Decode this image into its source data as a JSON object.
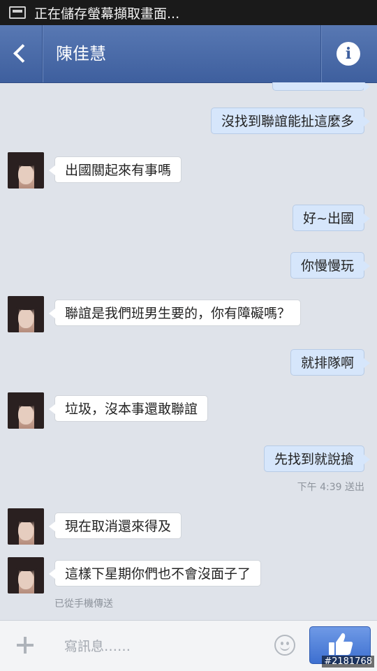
{
  "status_bar": {
    "notification_text": "正在儲存螢幕擷取畫面..."
  },
  "header": {
    "contact_name": "陳佳慧",
    "info_glyph": "i"
  },
  "messages": [
    {
      "dir": "out",
      "text": "沒找到聯誼能扯這麼多"
    },
    {
      "dir": "in",
      "text": "出國關起來有事嗎"
    },
    {
      "dir": "out",
      "text": "好~出國"
    },
    {
      "dir": "out",
      "text": "你慢慢玩"
    },
    {
      "dir": "in",
      "text": "聯誼是我們班男生要的，你有障礙嗎？"
    },
    {
      "dir": "out",
      "text": "就排隊啊"
    },
    {
      "dir": "in",
      "text": "垃圾，沒本事還敢聯誼"
    },
    {
      "dir": "out",
      "text": "先找到就說搶"
    },
    {
      "dir": "in",
      "text": "現在取消還來得及"
    },
    {
      "dir": "in",
      "text": "這樣下星期你們也不會沒面子了"
    }
  ],
  "sent_meta": "下午 4:39 送出",
  "mobile_meta": "已從手機傳送",
  "composer": {
    "placeholder": "寫訊息……"
  },
  "watermark": "#2181768",
  "colors": {
    "header_blue": "#4a6aa8",
    "outgoing_bubble": "#d6e6fb",
    "incoming_bubble": "#ffffff",
    "like_button": "#4f7fdb"
  },
  "icons": [
    "back-chevron-icon",
    "info-icon",
    "plus-icon",
    "emoji-icon",
    "thumbs-up-icon",
    "screenshot-icon"
  ]
}
